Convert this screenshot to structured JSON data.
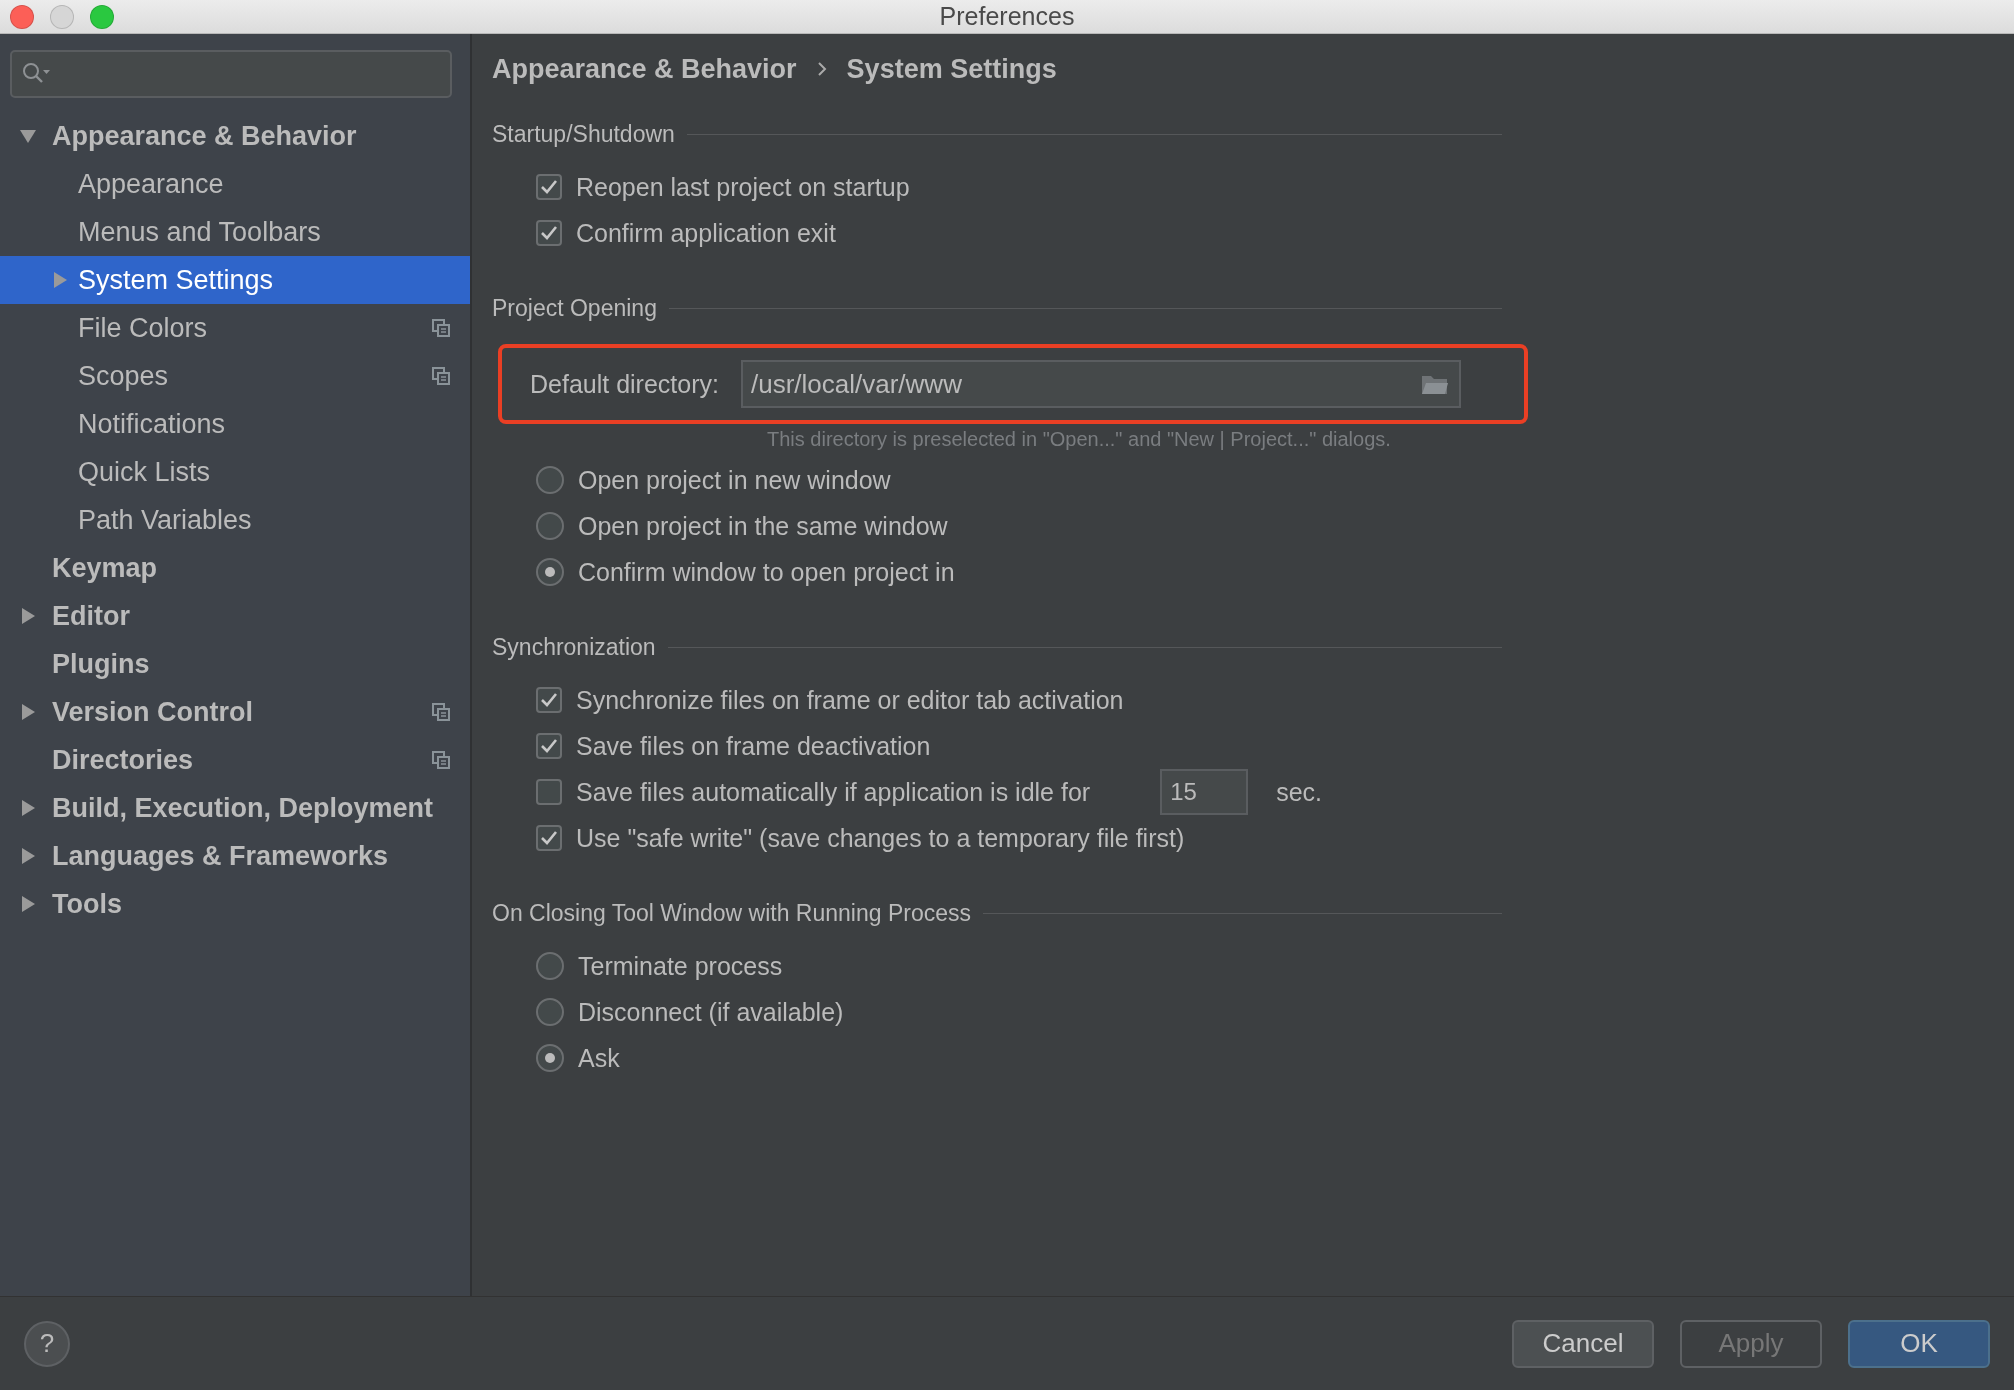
{
  "window": {
    "title": "Preferences"
  },
  "sidebar": {
    "items": [
      {
        "label": "Appearance & Behavior",
        "bold": true,
        "selected": false,
        "expanded": true,
        "project_icon": false,
        "children": [
          {
            "label": "Appearance",
            "bold": false,
            "selected": false,
            "project_icon": false
          },
          {
            "label": "Menus and Toolbars",
            "bold": false,
            "selected": false,
            "project_icon": false
          },
          {
            "label": "System Settings",
            "bold": false,
            "selected": true,
            "expanded": false,
            "project_icon": false
          },
          {
            "label": "File Colors",
            "bold": false,
            "selected": false,
            "project_icon": true
          },
          {
            "label": "Scopes",
            "bold": false,
            "selected": false,
            "project_icon": true
          },
          {
            "label": "Notifications",
            "bold": false,
            "selected": false,
            "project_icon": false
          },
          {
            "label": "Quick Lists",
            "bold": false,
            "selected": false,
            "project_icon": false
          },
          {
            "label": "Path Variables",
            "bold": false,
            "selected": false,
            "project_icon": false
          }
        ]
      },
      {
        "label": "Keymap",
        "bold": true,
        "selected": false,
        "project_icon": false
      },
      {
        "label": "Editor",
        "bold": true,
        "selected": false,
        "expanded": false,
        "project_icon": false
      },
      {
        "label": "Plugins",
        "bold": true,
        "selected": false,
        "project_icon": false
      },
      {
        "label": "Version Control",
        "bold": true,
        "selected": false,
        "expanded": false,
        "project_icon": true
      },
      {
        "label": "Directories",
        "bold": true,
        "selected": false,
        "project_icon": true
      },
      {
        "label": "Build, Execution, Deployment",
        "bold": true,
        "selected": false,
        "expanded": false,
        "project_icon": false
      },
      {
        "label": "Languages & Frameworks",
        "bold": true,
        "selected": false,
        "expanded": false,
        "project_icon": false
      },
      {
        "label": "Tools",
        "bold": true,
        "selected": false,
        "expanded": false,
        "project_icon": false
      }
    ]
  },
  "breadcrumb": [
    "Appearance & Behavior",
    "System Settings"
  ],
  "sections": [
    {
      "title": "Startup/Shutdown",
      "items": [
        {
          "kind": "checkbox",
          "label": "Reopen last project on startup",
          "checked": true
        },
        {
          "kind": "checkbox",
          "label": "Confirm application exit",
          "checked": true
        }
      ]
    },
    {
      "title": "Project Opening",
      "items": [
        {
          "kind": "directory",
          "label": "Default directory:",
          "value": "/usr/local/var/www",
          "hint": "This directory is preselected in \"Open...\" and \"New | Project...\" dialogs.",
          "highlighted": true
        },
        {
          "kind": "radio",
          "label": "Open project in new window",
          "selected": false
        },
        {
          "kind": "radio",
          "label": "Open project in the same window",
          "selected": false
        },
        {
          "kind": "radio",
          "label": "Confirm window to open project in",
          "selected": true
        }
      ]
    },
    {
      "title": "Synchronization",
      "items": [
        {
          "kind": "checkbox",
          "label": "Synchronize files on frame or editor tab activation",
          "checked": true
        },
        {
          "kind": "checkbox",
          "label": "Save files on frame deactivation",
          "checked": true
        },
        {
          "kind": "checkbox_number",
          "label": "Save files automatically if application is idle for",
          "checked": false,
          "value": "15",
          "unit": "sec."
        },
        {
          "kind": "checkbox",
          "label": "Use \"safe write\" (save changes to a temporary file first)",
          "checked": true
        }
      ]
    },
    {
      "title": "On Closing Tool Window with Running Process",
      "items": [
        {
          "kind": "radio",
          "label": "Terminate process",
          "selected": false
        },
        {
          "kind": "radio",
          "label": "Disconnect (if available)",
          "selected": false
        },
        {
          "kind": "radio",
          "label": "Ask",
          "selected": true
        }
      ]
    }
  ],
  "footer": {
    "help": "?",
    "buttons": [
      {
        "label": "Cancel",
        "disabled": false,
        "default": false
      },
      {
        "label": "Apply",
        "disabled": true,
        "default": false
      },
      {
        "label": "OK",
        "disabled": false,
        "default": true
      }
    ]
  }
}
